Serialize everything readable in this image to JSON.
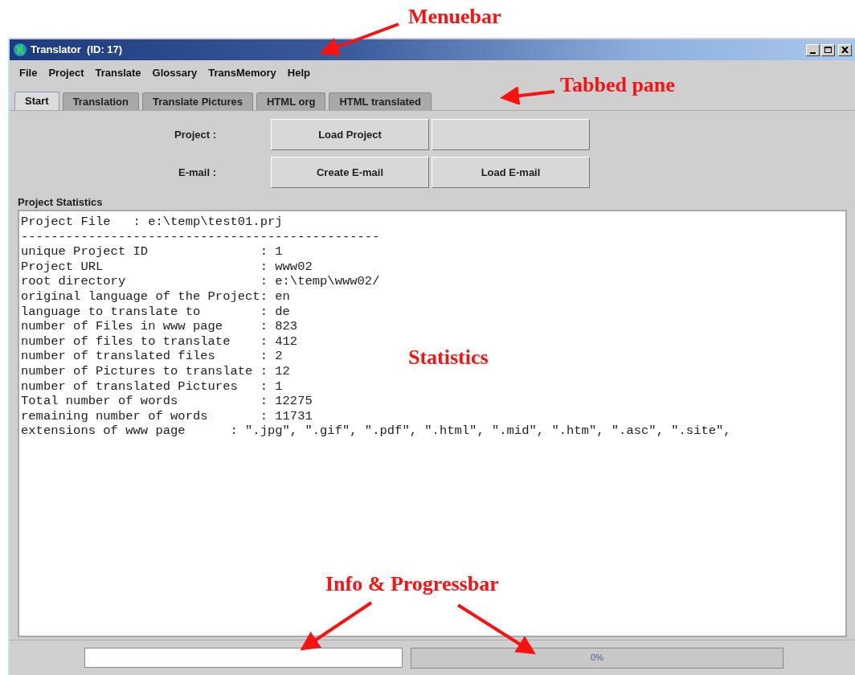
{
  "window": {
    "title": "Translator  (ID: 17)"
  },
  "menu": [
    "File",
    "Project",
    "Translate",
    "Glossary",
    "TransMemory",
    "Help"
  ],
  "tabs": [
    {
      "label": "Start",
      "selected": true
    },
    {
      "label": "Translation",
      "selected": false
    },
    {
      "label": "Translate Pictures",
      "selected": false
    },
    {
      "label": "HTML org",
      "selected": false
    },
    {
      "label": "HTML translated",
      "selected": false
    }
  ],
  "action_rows": [
    {
      "label": "Project :",
      "buttons": [
        "Load Project"
      ]
    },
    {
      "label": "E-mail :",
      "buttons": [
        "Create E-mail",
        "Load E-mail"
      ]
    }
  ],
  "statistics": {
    "title": "Project Statistics",
    "lines": [
      "Project File   : e:\\temp\\test01.prj",
      "------------------------------------------------",
      "unique Project ID               : 1",
      "Project URL                     : www02",
      "root directory                  : e:\\temp\\www02/",
      "original language of the Project: en",
      "language to translate to        : de",
      "number of Files in www page     : 823",
      "number of files to translate    : 412",
      "number of translated files      : 2",
      "number of Pictures to translate : 12",
      "number of translated Pictures   : 1",
      "Total number of words           : 12275",
      "remaining number of words       : 11731",
      "extensions of www page      : \".jpg\", \".gif\", \".pdf\", \".html\", \".mid\", \".htm\", \".asc\", \".site\","
    ]
  },
  "status_bar": {
    "progress": {
      "level": 0,
      "reading": "0%"
    }
  },
  "annotations": [
    {
      "text": "Menuebar"
    },
    {
      "text": "Tabbed pane"
    },
    {
      "text": "Statistics"
    },
    {
      "text": "Info & Progressbar"
    }
  ]
}
